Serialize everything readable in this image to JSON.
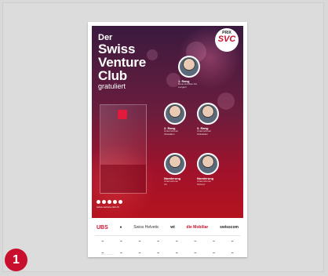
{
  "poster": {
    "title_line1": "Der",
    "title_line2": "Swiss",
    "title_line3": "Venture",
    "title_line4": "Club",
    "title_line5": "gratuliert",
    "logo": {
      "prix": "PRIX",
      "svc": "SVC"
    },
    "persons": [
      {
        "rank": "1. Rang",
        "lines": [
          "Neue Holzbau AG",
          "Lungern"
        ]
      },
      {
        "rank": "2. Rang",
        "lines": [
          "Unternehmen",
          "Obwalden"
        ]
      },
      {
        "rank": "3. Rang",
        "lines": [
          "Unternehmen",
          "Nidwalden"
        ]
      },
      {
        "rank": "Nomierung",
        "lines": [
          "Unternehmen",
          "Uri"
        ]
      },
      {
        "rank": "Nomierung",
        "lines": [
          "Unternehmen",
          "Schwyz"
        ]
      }
    ],
    "footer_small": "swiss-venture-club.ch"
  },
  "sponsors": {
    "main": [
      "UBS",
      "",
      "Swiss Helvetic",
      "wt",
      "die Mobiliar",
      "swisscom"
    ],
    "row1": [
      "",
      "",
      "",
      "",
      "",
      "",
      "",
      "",
      "",
      ""
    ],
    "row2": [
      "",
      "",
      "",
      "",
      "",
      "",
      "",
      "",
      "",
      ""
    ]
  },
  "badge": {
    "number": "1"
  }
}
